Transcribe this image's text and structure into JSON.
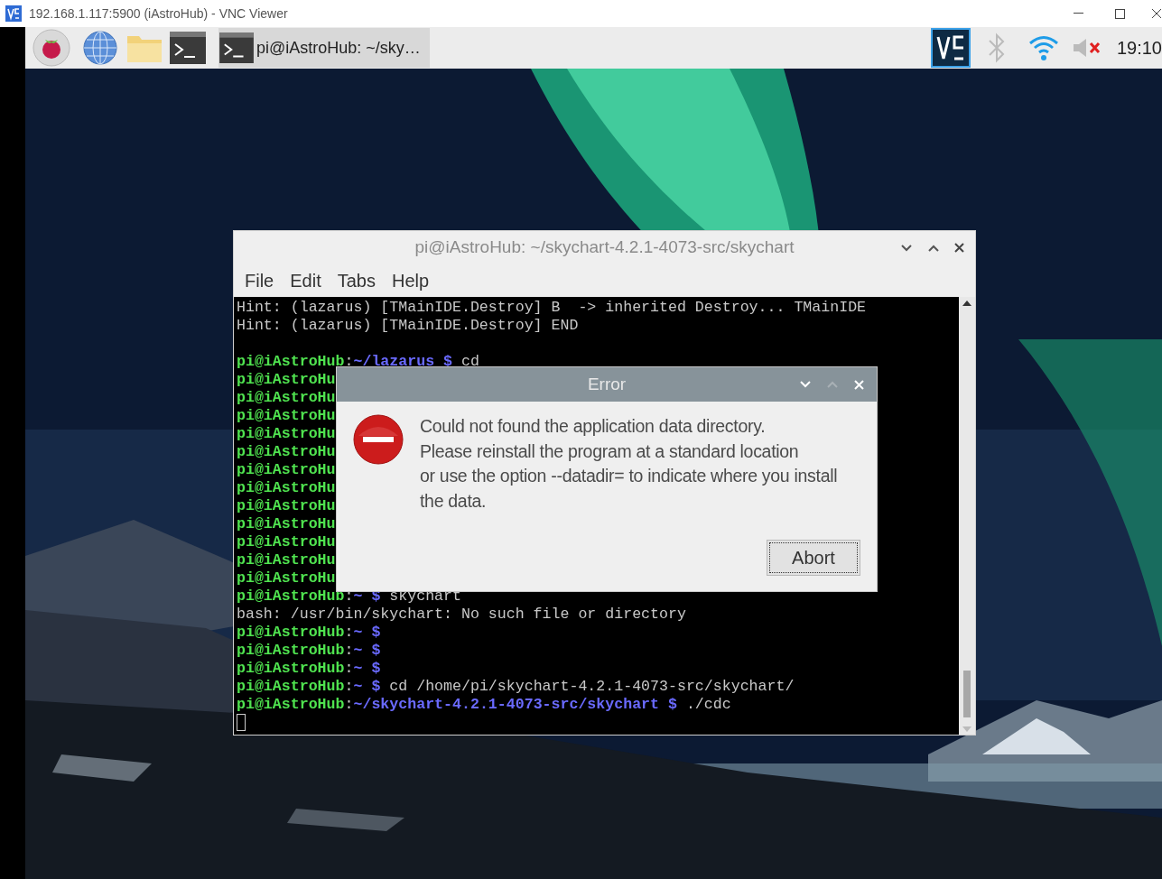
{
  "viewer": {
    "title": "192.168.1.117:5900 (iAstroHub) - VNC Viewer"
  },
  "taskbar": {
    "task": "pi@iAstroHub: ~/sky…",
    "clock": "19:10"
  },
  "terminal": {
    "title": "pi@iAstroHub: ~/skychart-4.2.1-4073-src/skychart",
    "menu": [
      "File",
      "Edit",
      "Tabs",
      "Help"
    ],
    "lines": [
      [
        {
          "kind": "plain",
          "text": "Hint: (lazarus) [TMainIDE.Destroy] B  -> inherited Destroy... TMainIDE"
        }
      ],
      [
        {
          "kind": "plain",
          "text": "Hint: (lazarus) [TMainIDE.Destroy] END"
        }
      ],
      {
        "blank_before": true,
        "segments": [
          {
            "kind": "user",
            "text": "pi@iAstroHub"
          },
          {
            "kind": "plain",
            "text": ":"
          },
          {
            "kind": "path",
            "text": "~/lazarus $"
          },
          {
            "kind": "plain",
            "text": " cd"
          }
        ]
      },
      [
        {
          "kind": "user",
          "text": "pi@iAstroHu"
        }
      ],
      [
        {
          "kind": "user",
          "text": "pi@iAstroHu"
        }
      ],
      [
        {
          "kind": "user",
          "text": "pi@iAstroHu"
        }
      ],
      [
        {
          "kind": "user",
          "text": "pi@iAstroHu"
        }
      ],
      [
        {
          "kind": "user",
          "text": "pi@iAstroHu"
        }
      ],
      [
        {
          "kind": "user",
          "text": "pi@iAstroHu"
        }
      ],
      [
        {
          "kind": "user",
          "text": "pi@iAstroHu"
        }
      ],
      [
        {
          "kind": "user",
          "text": "pi@iAstroHu"
        }
      ],
      [
        {
          "kind": "user",
          "text": "pi@iAstroHu"
        }
      ],
      [
        {
          "kind": "user",
          "text": "pi@iAstroHu"
        }
      ],
      [
        {
          "kind": "user",
          "text": "pi@iAstroHu"
        }
      ],
      [
        {
          "kind": "user",
          "text": "pi@iAstroHu"
        }
      ],
      [
        {
          "kind": "user",
          "text": "pi@iAstroHub"
        },
        {
          "kind": "plain",
          "text": ":"
        },
        {
          "kind": "path",
          "text": "~ $"
        },
        {
          "kind": "plain",
          "text": " skychart"
        }
      ],
      [
        {
          "kind": "plain",
          "text": "bash: /usr/bin/skychart: No such file or directory"
        }
      ],
      [
        {
          "kind": "user",
          "text": "pi@iAstroHub"
        },
        {
          "kind": "plain",
          "text": ":"
        },
        {
          "kind": "path",
          "text": "~ $"
        }
      ],
      [
        {
          "kind": "user",
          "text": "pi@iAstroHub"
        },
        {
          "kind": "plain",
          "text": ":"
        },
        {
          "kind": "path",
          "text": "~ $"
        }
      ],
      [
        {
          "kind": "user",
          "text": "pi@iAstroHub"
        },
        {
          "kind": "plain",
          "text": ":"
        },
        {
          "kind": "path",
          "text": "~ $"
        }
      ],
      [
        {
          "kind": "user",
          "text": "pi@iAstroHub"
        },
        {
          "kind": "plain",
          "text": ":"
        },
        {
          "kind": "path",
          "text": "~ $"
        },
        {
          "kind": "plain",
          "text": " cd /home/pi/skychart-4.2.1-4073-src/skychart/"
        }
      ],
      [
        {
          "kind": "user",
          "text": "pi@iAstroHub"
        },
        {
          "kind": "plain",
          "text": ":"
        },
        {
          "kind": "path",
          "text": "~/skychart-4.2.1-4073-src/skychart $"
        },
        {
          "kind": "plain",
          "text": " ./cdc"
        }
      ]
    ]
  },
  "dialog": {
    "title": "Error",
    "message": [
      "Could not found the application data directory.",
      "Please reinstall the program at a standard location",
      "or use the option --datadir= to indicate where you install",
      "the data."
    ],
    "button": "Abort"
  }
}
